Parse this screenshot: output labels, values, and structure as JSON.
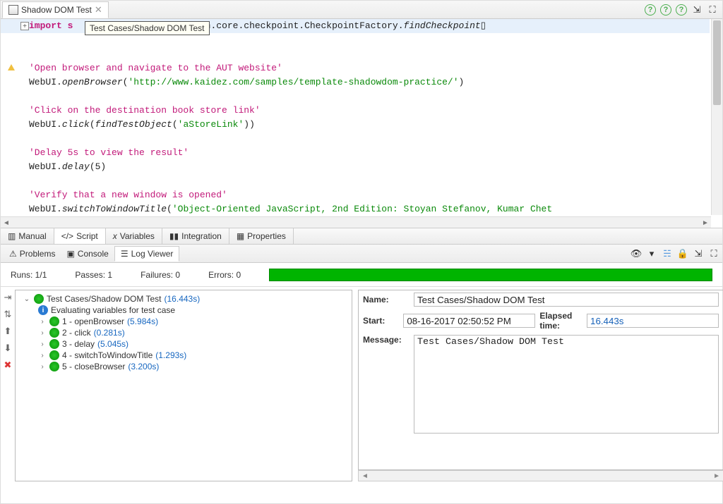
{
  "tab": {
    "title": "Shadow DOM Test"
  },
  "tooltip": "Test Cases/Shadow DOM Test",
  "code": {
    "import_head": "import s",
    "import_tail": "on.core.checkpoint.CheckpointFactory.",
    "import_method": "findCheckpoint",
    "c1": "'Open browser and navigate to the AUT website'",
    "l1a": "WebUI.",
    "l1b": "openBrowser",
    "l1c": "(",
    "l1d": "'http://www.kaidez.com/samples/template-shadowdom-practice/'",
    "l1e": ")",
    "c2": "'Click on the destination book store link'",
    "l2a": "WebUI.",
    "l2b": "click",
    "l2c": "(",
    "l2d": "findTestObject",
    "l2e": "(",
    "l2f": "'aStoreLink'",
    "l2g": "))",
    "c3": "'Delay 5s to view the result'",
    "l3a": "WebUI.",
    "l3b": "delay",
    "l3c": "(5)",
    "c4": "'Verify that a new window is opened'",
    "l4a": "WebUI.",
    "l4b": "switchToWindowTitle",
    "l4c": "(",
    "l4d": "'Object-Oriented JavaScript, 2nd Edition: Stoyan Stefanov, Kumar Chet"
  },
  "editorTabs": {
    "manual": "Manual",
    "script": "Script",
    "variables": "Variables",
    "integration": "Integration",
    "properties": "Properties"
  },
  "panelTabs": {
    "problems": "Problems",
    "console": "Console",
    "logviewer": "Log Viewer"
  },
  "runs": {
    "runs": "Runs:  1/1",
    "passes": "Passes:  1",
    "failures": "Failures:  0",
    "errors": "Errors:  0"
  },
  "tree": {
    "root": "Test Cases/Shadow DOM Test",
    "root_dur": "(16.443s)",
    "eval": "Evaluating variables for test case",
    "items": [
      {
        "name": "1 - openBrowser",
        "dur": "(5.984s)"
      },
      {
        "name": "2 - click",
        "dur": "(0.281s)"
      },
      {
        "name": "3 - delay",
        "dur": "(5.045s)"
      },
      {
        "name": "4 - switchToWindowTitle",
        "dur": "(1.293s)"
      },
      {
        "name": "5 - closeBrowser",
        "dur": "(3.200s)"
      }
    ]
  },
  "detail": {
    "name_label": "Name:",
    "name": "Test Cases/Shadow DOM Test",
    "start_label": "Start:",
    "start": "08-16-2017 02:50:52 PM",
    "elapsed_label": "Elapsed time:",
    "elapsed": "16.443s",
    "message_label": "Message:",
    "message": "Test Cases/Shadow DOM Test"
  }
}
